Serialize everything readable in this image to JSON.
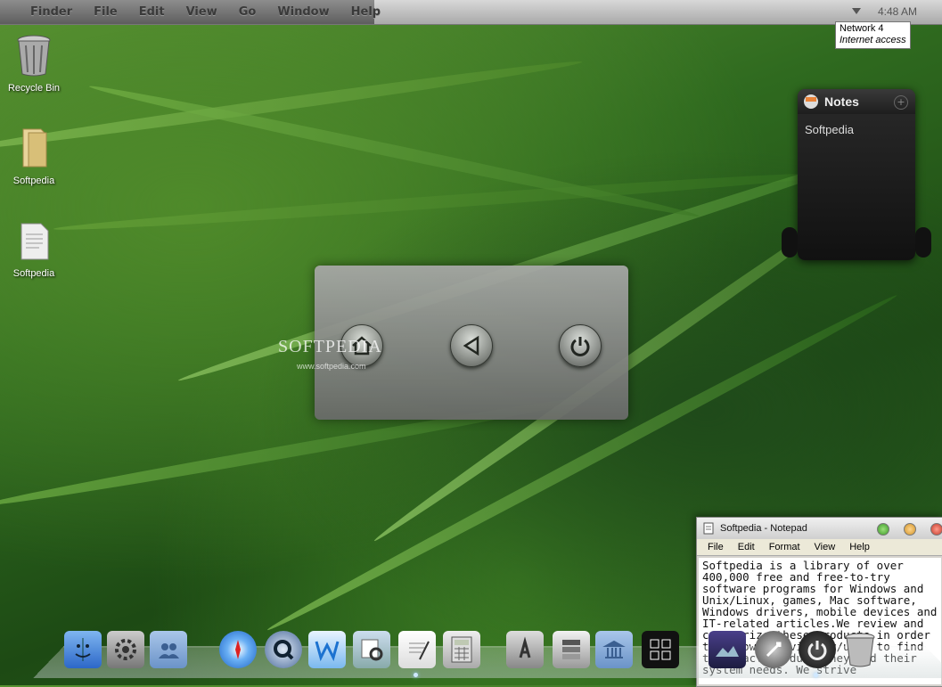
{
  "menubar": {
    "items": [
      "Finder",
      "File",
      "Edit",
      "View",
      "Go",
      "Window",
      "Help"
    ],
    "clock": "4:48 AM"
  },
  "tooltip": {
    "title": "Network  4",
    "subtitle": "Internet access"
  },
  "desktop_icons": [
    {
      "label": "Recycle Bin",
      "icon": "trash-icon"
    },
    {
      "label": "Softpedia",
      "icon": "folder-icon"
    },
    {
      "label": "Softpedia",
      "icon": "text-document-icon"
    }
  ],
  "notes_widget": {
    "title": "Notes",
    "content": "Softpedia",
    "add_label": "+"
  },
  "power_panel": {
    "buttons": [
      "home-icon",
      "back-icon",
      "power-icon"
    ],
    "watermark": "SOFTPEDIA",
    "watermark_sub": "www.softpedia.com"
  },
  "notepad": {
    "title": "Softpedia - Notepad",
    "menu": [
      "File",
      "Edit",
      "Format",
      "View",
      "Help"
    ],
    "text": "Softpedia is a library of over 400,000 free and free-to-try software programs for Windows and Unix/Linux, games, Mac software, Windows drivers, mobile devices and IT-related articles.We review and categorize these products in order to allow the visitor/user to find the exact product they and their system needs. We strive"
  },
  "dock": {
    "items": [
      "finder-icon",
      "system-preferences-icon",
      "users-folder-icon",
      "safari-icon",
      "quicktime-icon",
      "mail-icon",
      "preview-icon",
      "textedit-icon",
      "calculator-icon",
      "app-store-icon",
      "boot-camp-icon",
      "library-folder-icon",
      "dashboard-icon",
      "wallpaper-icon",
      "launchpad-icon",
      "shutdown-icon",
      "dock-trash-icon"
    ]
  },
  "colors": {
    "grass_dark": "#1d4a14",
    "grass_light": "#5d9636"
  }
}
